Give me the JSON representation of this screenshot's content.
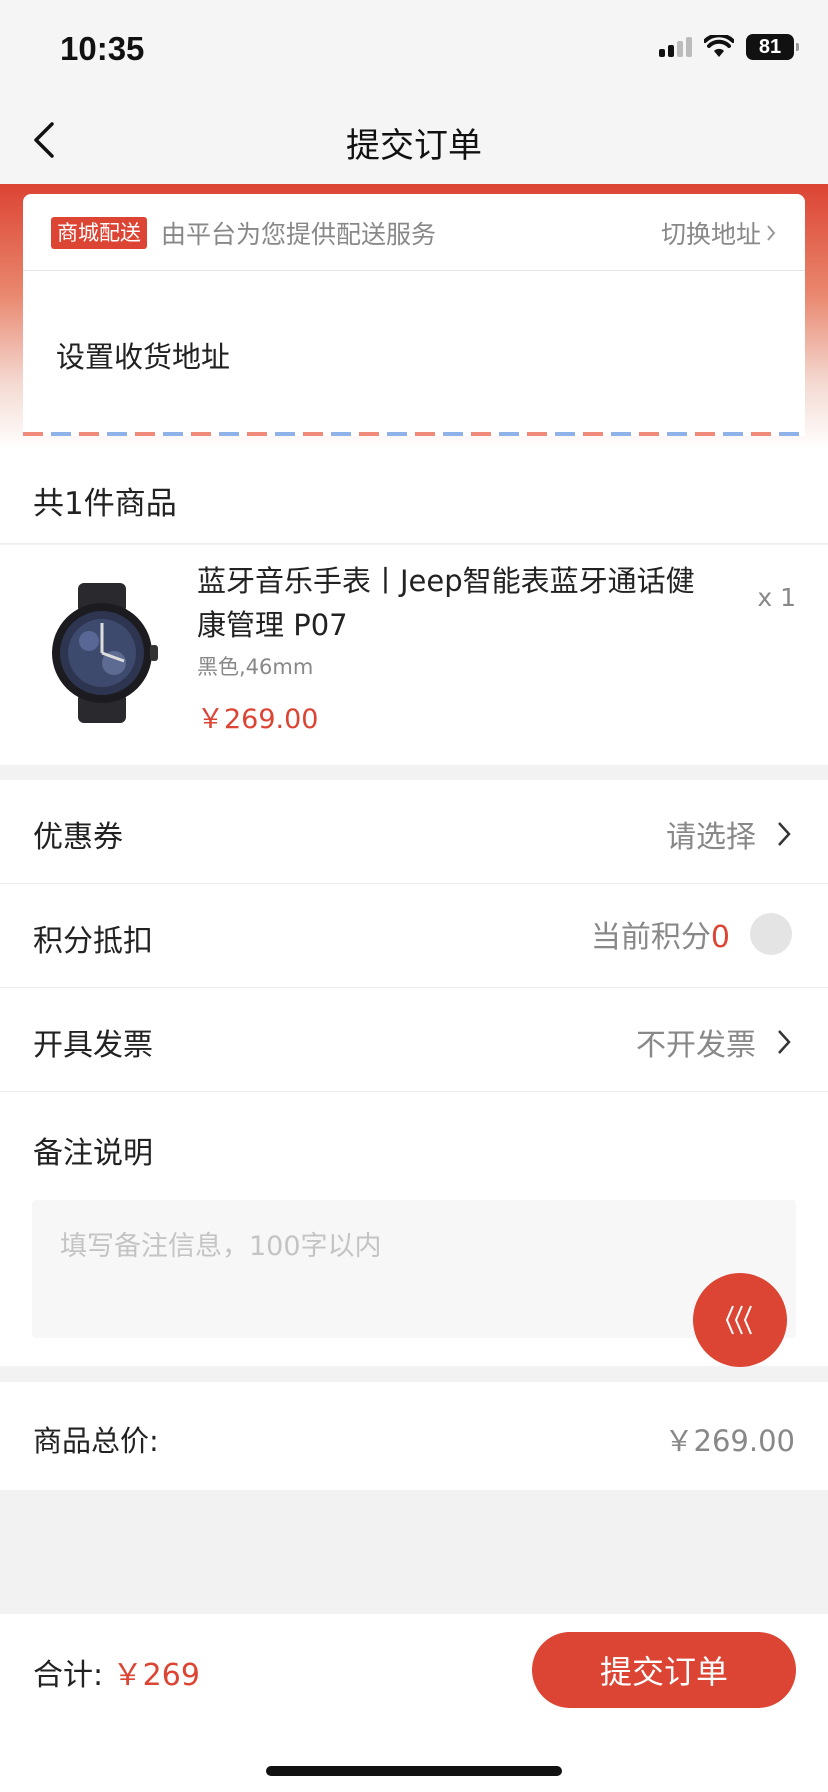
{
  "status_bar": {
    "time": "10:35",
    "battery": "81"
  },
  "nav": {
    "title": "提交订单"
  },
  "address": {
    "badge": "商城配送",
    "description": "由平台为您提供配送服务",
    "switch_label": "切换地址",
    "placeholder_text": "设置收货地址"
  },
  "goods": {
    "count_label": "共1件商品",
    "items": [
      {
        "name": "蓝牙音乐手表丨Jeep智能表蓝牙通话健康管理 P07",
        "spec": "黑色,46mm",
        "price": "￥269.00",
        "quantity": "x 1"
      }
    ]
  },
  "options": {
    "coupon": {
      "label": "优惠券",
      "value": "请选择"
    },
    "points": {
      "label": "积分抵扣",
      "value_prefix": "当前积分",
      "value": "0",
      "enabled": false
    },
    "invoice": {
      "label": "开具发票",
      "value": "不开发票"
    },
    "remark": {
      "label": "备注说明",
      "placeholder": "填写备注信息，100字以内"
    }
  },
  "summary": {
    "label": "商品总价:",
    "value": "￥269.00"
  },
  "footer": {
    "total_label": "合计:",
    "total_value": "￥269",
    "submit_label": "提交订单"
  },
  "colors": {
    "accent": "#dc4433",
    "background": "#f2f2f2",
    "muted_text": "#888888"
  }
}
